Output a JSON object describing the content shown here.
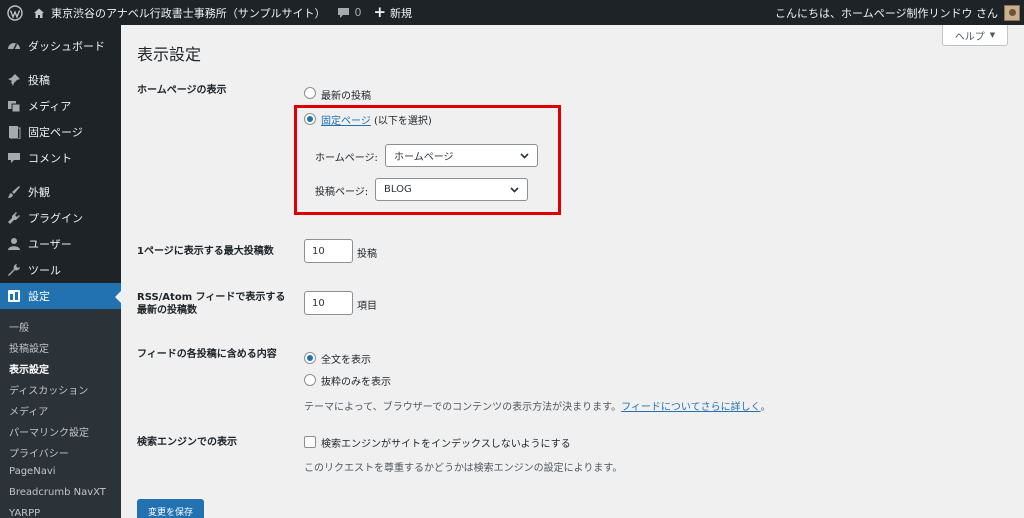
{
  "adminbar": {
    "site_name": "東京渋谷のアナベル行政書士事務所（サンプルサイト）",
    "comments_count": "0",
    "new_label": "新規",
    "greeting": "こんにちは、ホームページ制作リンドウ さん"
  },
  "sidebar": {
    "items": [
      {
        "label": "ダッシュボード",
        "icon": "dashboard-icon"
      },
      {
        "label": "投稿",
        "icon": "pin-icon"
      },
      {
        "label": "メディア",
        "icon": "media-icon"
      },
      {
        "label": "固定ページ",
        "icon": "page-icon"
      },
      {
        "label": "コメント",
        "icon": "comment-icon"
      },
      {
        "label": "外観",
        "icon": "brush-icon"
      },
      {
        "label": "プラグイン",
        "icon": "plugin-icon"
      },
      {
        "label": "ユーザー",
        "icon": "user-icon"
      },
      {
        "label": "ツール",
        "icon": "wrench-icon"
      },
      {
        "label": "設定",
        "icon": "settings-icon"
      }
    ],
    "submenu": [
      "一般",
      "投稿設定",
      "表示設定",
      "ディスカッション",
      "メディア",
      "パーマリンク設定",
      "プライバシー",
      "PageNavi",
      "Breadcrumb NavXT",
      "YARPP"
    ],
    "active_submenu": "表示設定"
  },
  "help": {
    "label": "ヘルプ"
  },
  "page": {
    "title": "表示設定"
  },
  "homepage_display": {
    "label": "ホームページの表示",
    "option_latest": "最新の投稿",
    "option_static_link": "固定ページ",
    "option_static_suffix": " (以下を選択)",
    "selected": "static",
    "homepage_label": "ホームページ:",
    "homepage_value": "ホームページ",
    "posts_page_label": "投稿ページ:",
    "posts_page_value": "BLOG"
  },
  "posts_per_page": {
    "label": "1ページに表示する最大投稿数",
    "value": "10",
    "unit": "投稿"
  },
  "rss_items": {
    "label_line1": "RSS/Atom フィードで表示する",
    "label_line2": "最新の投稿数",
    "value": "10",
    "unit": "項目"
  },
  "feed_content": {
    "label": "フィードの各投稿に含める内容",
    "option_full": "全文を表示",
    "option_excerpt": "抜粋のみを表示",
    "selected": "full",
    "description": "テーマによって、ブラウザーでのコンテンツの表示方法が決まります。",
    "description_link": "フィードについてさらに詳しく",
    "description_end": "。"
  },
  "search_engine": {
    "label": "検索エンジンでの表示",
    "checkbox_label": "検索エンジンがサイトをインデックスしないようにする",
    "checked": false,
    "description": "このリクエストを尊重するかどうかは検索エンジンの設定によります。"
  },
  "save_button": {
    "label": "変更を保存"
  },
  "colors": {
    "accent": "#2271b1",
    "highlight": "#e00000",
    "sidebar_bg": "#1d2327"
  }
}
